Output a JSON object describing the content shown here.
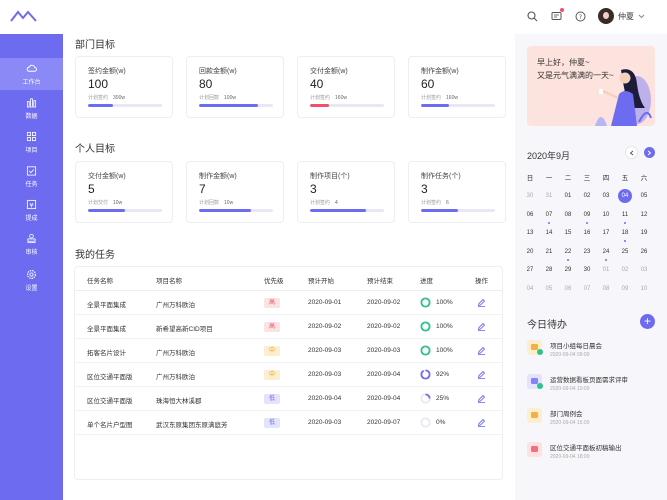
{
  "user": {
    "name": "仲夏"
  },
  "sidebar": {
    "items": [
      {
        "label": "工作台",
        "icon": "cloud-icon"
      },
      {
        "label": "数据",
        "icon": "bar-chart-icon"
      },
      {
        "label": "项目",
        "icon": "grid-icon"
      },
      {
        "label": "任务",
        "icon": "calendar-check-icon"
      },
      {
        "label": "提成",
        "icon": "yen-icon"
      },
      {
        "label": "审核",
        "icon": "stamp-icon"
      },
      {
        "label": "设置",
        "icon": "gear-icon"
      }
    ]
  },
  "dept": {
    "title": "部门目标",
    "cards": [
      {
        "title": "签约金额(w)",
        "value": "100",
        "sub_label": "计划签约",
        "sub_value": "300w",
        "progress": 0.34,
        "color": "#6d6cf0"
      },
      {
        "title": "回款金额(w)",
        "value": "80",
        "sub_label": "计划回款",
        "sub_value": "100w",
        "progress": 0.8,
        "color": "#6d6cf0"
      },
      {
        "title": "交付金额(w)",
        "value": "40",
        "sub_label": "计划签约",
        "sub_value": "160w",
        "progress": 0.25,
        "color": "#f0506e"
      },
      {
        "title": "制作金额(w)",
        "value": "60",
        "sub_label": "计划签约",
        "sub_value": "160w",
        "progress": 0.38,
        "color": "#6d6cf0"
      }
    ]
  },
  "personal": {
    "title": "个人目标",
    "cards": [
      {
        "title": "交付金额(w)",
        "value": "5",
        "sub_label": "计划交付",
        "sub_value": "10w",
        "progress": 0.5,
        "color": "#6d6cf0"
      },
      {
        "title": "制作金额(w)",
        "value": "7",
        "sub_label": "计划回款",
        "sub_value": "10w",
        "progress": 0.7,
        "color": "#6d6cf0"
      },
      {
        "title": "制作项目(个)",
        "value": "3",
        "sub_label": "计划签约",
        "sub_value": "4",
        "progress": 0.75,
        "color": "#6d6cf0"
      },
      {
        "title": "制作任务(个)",
        "value": "3",
        "sub_label": "计划签约",
        "sub_value": "6",
        "progress": 0.5,
        "color": "#6d6cf0"
      }
    ]
  },
  "tasks": {
    "title": "我的任务",
    "headers": [
      "任务名称",
      "项目名称",
      "优先级",
      "预计开始",
      "预计结束",
      "进度",
      "操作"
    ],
    "rows": [
      {
        "name": "全景平面集成",
        "project": "广州万科欧泊",
        "priority": "高",
        "start": "2020-09-01",
        "end": "2020-09-02",
        "progress": "100%",
        "pct": 1.0
      },
      {
        "name": "全景平面集成",
        "project": "新希望高新CID项目",
        "priority": "高",
        "start": "2020-09-02",
        "end": "2020-09-02",
        "progress": "100%",
        "pct": 1.0
      },
      {
        "name": "拓客名片设计",
        "project": "广州万科欧泊",
        "priority": "中",
        "start": "2020-09-03",
        "end": "2020-09-03",
        "progress": "100%",
        "pct": 1.0
      },
      {
        "name": "区位交通平面版",
        "project": "广州万科欧泊",
        "priority": "中",
        "start": "2020-09-03",
        "end": "2020-09-04",
        "progress": "92%",
        "pct": 0.92
      },
      {
        "name": "区位交通平面版",
        "project": "珠海恒大林溪郡",
        "priority": "低",
        "start": "2020-09-04",
        "end": "2020-09-04",
        "progress": "25%",
        "pct": 0.25
      },
      {
        "name": "单个名片户型图",
        "project": "武汉东原集团东原满庭芳",
        "priority": "低",
        "start": "2020-09-03",
        "end": "2020-09-07",
        "progress": "0%",
        "pct": 0
      }
    ]
  },
  "welcome": {
    "line1": "早上好，仲夏~",
    "line2": "又是元气满满的一天~"
  },
  "calendar": {
    "month_label": "2020年9月",
    "weekdays": [
      "日",
      "一",
      "二",
      "三",
      "四",
      "五",
      "六"
    ],
    "days": [
      {
        "d": "30",
        "m": true
      },
      {
        "d": "31",
        "m": true
      },
      {
        "d": "01"
      },
      {
        "d": "02"
      },
      {
        "d": "03"
      },
      {
        "d": "04",
        "sel": true
      },
      {
        "d": "05"
      },
      {
        "d": "06"
      },
      {
        "d": "07",
        "dot": true
      },
      {
        "d": "08"
      },
      {
        "d": "09",
        "dot": true
      },
      {
        "d": "10"
      },
      {
        "d": "11",
        "dot": true
      },
      {
        "d": "12"
      },
      {
        "d": "13"
      },
      {
        "d": "14"
      },
      {
        "d": "15"
      },
      {
        "d": "16"
      },
      {
        "d": "17"
      },
      {
        "d": "18",
        "dot": true
      },
      {
        "d": "19"
      },
      {
        "d": "20"
      },
      {
        "d": "21"
      },
      {
        "d": "22",
        "dot": true
      },
      {
        "d": "23"
      },
      {
        "d": "24",
        "dot": true
      },
      {
        "d": "25"
      },
      {
        "d": "26"
      },
      {
        "d": "27"
      },
      {
        "d": "28"
      },
      {
        "d": "29"
      },
      {
        "d": "30"
      },
      {
        "d": "01",
        "m": true
      },
      {
        "d": "02",
        "m": true
      },
      {
        "d": "03",
        "m": true
      },
      {
        "d": "04",
        "m": true
      },
      {
        "d": "05",
        "m": true
      },
      {
        "d": "06",
        "m": true
      },
      {
        "d": "07",
        "m": true
      },
      {
        "d": "08",
        "m": true
      },
      {
        "d": "09",
        "m": true
      },
      {
        "d": "10",
        "m": true
      }
    ]
  },
  "todo": {
    "title": "今日待办",
    "items": [
      {
        "title": "项目小组每日晨会",
        "time": "2020-09-04 09:00",
        "color": "#fdeed0",
        "icon": "chat-icon",
        "done": true
      },
      {
        "title": "运营数据看板页面需求评审",
        "time": "2020-09-04 10:00",
        "color": "#e3e4fb",
        "icon": "document-icon",
        "done": true
      },
      {
        "title": "部门周例会",
        "time": "2020-09-04 15:00",
        "color": "#fdeed0",
        "icon": "chat-icon",
        "done": false
      },
      {
        "title": "区位交通平面板初稿输出",
        "time": "2020-09-04 18:00",
        "color": "#fde2e2",
        "icon": "pencil-icon",
        "done": false
      }
    ]
  }
}
